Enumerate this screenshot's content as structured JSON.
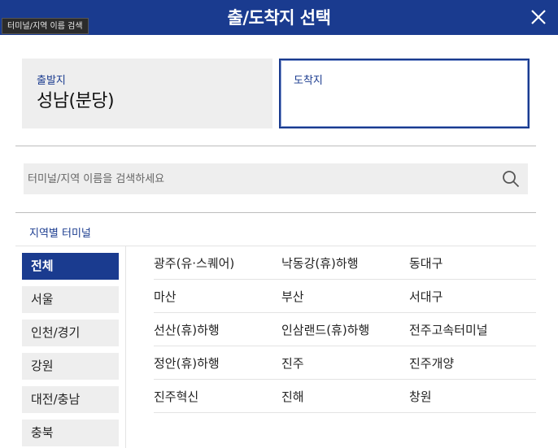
{
  "header": {
    "title": "출/도착지 선택"
  },
  "tooltip": {
    "text": "터미널/지역 이름 검색"
  },
  "origin": {
    "label": "출발지",
    "value": "성남(분당)"
  },
  "destination": {
    "label": "도착지",
    "value": ""
  },
  "search": {
    "placeholder": "터미널/지역 이름을 검색하세요"
  },
  "section": {
    "label": "지역별 터미널"
  },
  "regions": [
    {
      "label": "전체"
    },
    {
      "label": "서울"
    },
    {
      "label": "인천/경기"
    },
    {
      "label": "강원"
    },
    {
      "label": "대전/충남"
    },
    {
      "label": "충북"
    }
  ],
  "terminals": [
    [
      "광주(유·스퀘어)",
      "낙동강(휴)하행",
      "동대구"
    ],
    [
      "마산",
      "부산",
      "서대구"
    ],
    [
      "선산(휴)하행",
      "인삼랜드(휴)하행",
      "전주고속터미널"
    ],
    [
      "정안(휴)하행",
      "진주",
      "진주개양"
    ],
    [
      "진주혁신",
      "진해",
      "창원"
    ]
  ],
  "colors": {
    "accent": "#1a3b8f",
    "panel_bg": "#eeeeee"
  },
  "icons": {
    "close": "close-icon",
    "search": "search-icon"
  }
}
